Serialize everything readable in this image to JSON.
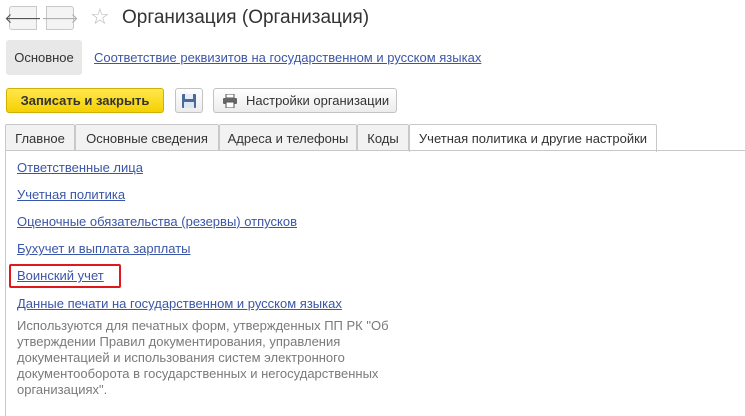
{
  "window": {
    "title": "Организация (Организация)",
    "back_icon": "arrow-left-icon",
    "forward_icon": "arrow-right-icon",
    "favorite_icon": "star-icon"
  },
  "subnav": {
    "main": "Основное",
    "link": "Соответствие реквизитов на государственном и русском языках"
  },
  "toolbar": {
    "save_close": "Записать и закрыть",
    "save_icon": "floppy-disk-icon",
    "settings_icon": "printer-icon",
    "settings": "Настройки организации"
  },
  "tabs": [
    {
      "label": "Главное"
    },
    {
      "label": "Основные сведения"
    },
    {
      "label": "Адреса и телефоны"
    },
    {
      "label": "Коды"
    },
    {
      "label": "Учетная политика и другие настройки"
    }
  ],
  "active_tab": 4,
  "links": [
    "Ответственные лица",
    "Учетная политика",
    "Оценочные обязательства (резервы) отпусков",
    "Бухучет и выплата зарплаты",
    "Воинский учет",
    "Данные печати на государственном и русском языках"
  ],
  "description": "Используются для печатных форм, утвержденных ПП РК \"Об утверждении Правил документирования, управления документацией и использования систем электронного документооборота в государственных и негосударственных организациях\".",
  "colors": {
    "link": "#3a56a8",
    "primary_button": "#f5d000",
    "highlight": "#e0181b"
  }
}
